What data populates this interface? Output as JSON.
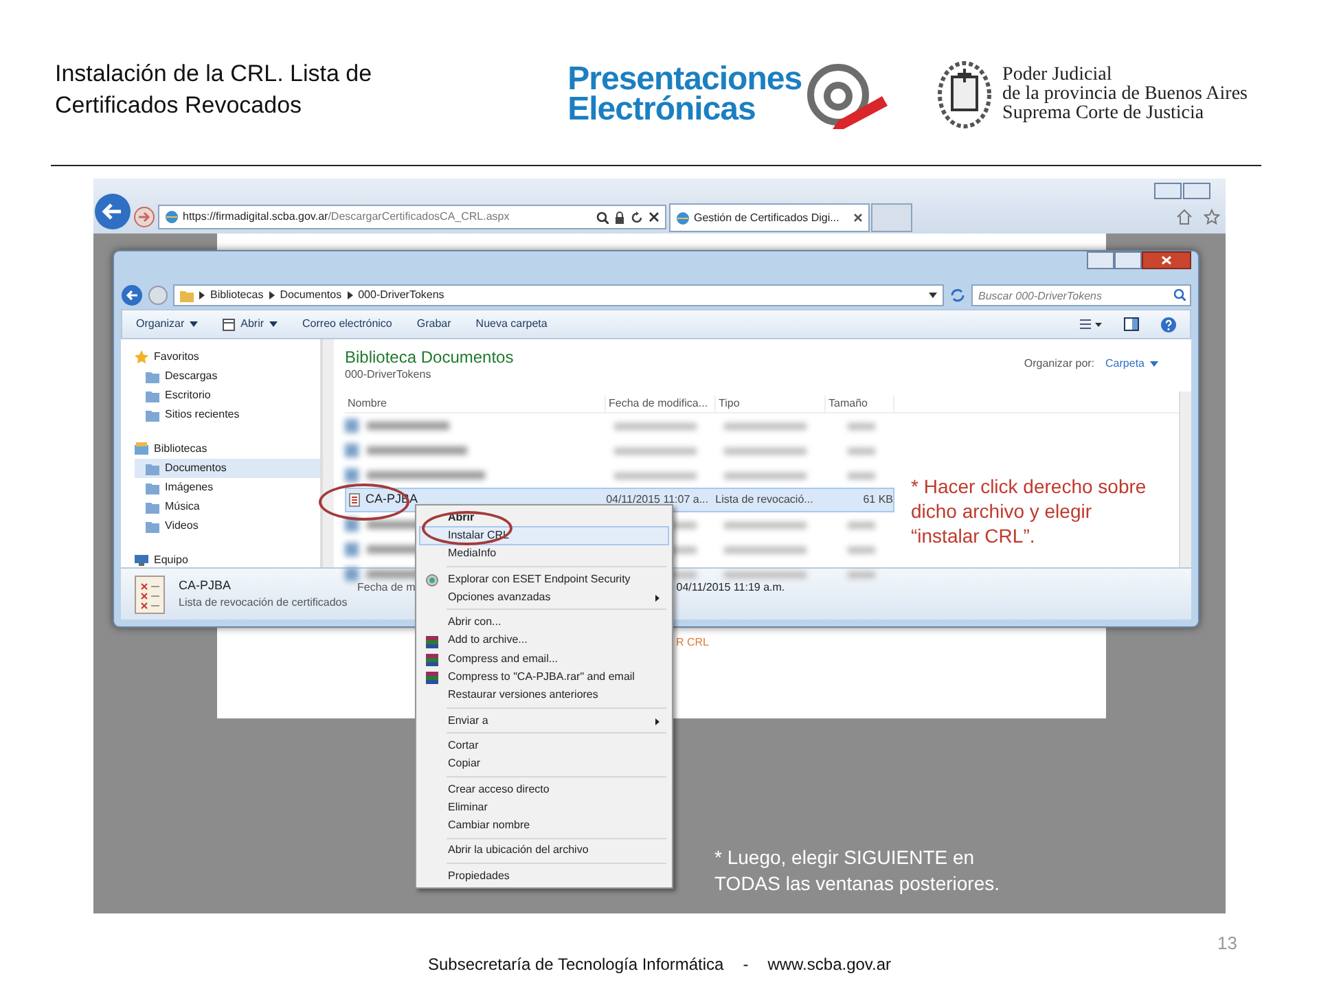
{
  "slide": {
    "title": "Instalación de la CRL. Lista de Certificados Revocados",
    "logo_lines": [
      "Presentaciones",
      "Electrónicas"
    ],
    "court_lines": [
      "Poder Judicial",
      "de la provincia de Buenos Aires",
      "Suprema Corte de Justicia"
    ],
    "footer": [
      "Subsecretaría de Tecnología Informática",
      "-",
      "www.scba.gov.ar"
    ],
    "page_number": "13"
  },
  "browser": {
    "url_host": "https://firmadigital.scba.gov.ar",
    "url_path": "/DescargarCertificadosCA_CRL.aspx",
    "tabs": [
      {
        "label": "Gestión de Certificados Digi...",
        "selected": true
      }
    ]
  },
  "page_fragment": "R CRL",
  "explorer": {
    "breadcrumb": [
      "Bibliotecas",
      "Documentos",
      "000-DriverTokens"
    ],
    "search": {
      "placeholder": "Buscar 000-DriverTokens"
    },
    "toolbar": [
      {
        "label": "Organizar",
        "dropdown": true
      },
      {
        "label": "Abrir",
        "dropdown": true
      },
      {
        "label": "Correo electrónico",
        "dropdown": false
      },
      {
        "label": "Grabar",
        "dropdown": false
      },
      {
        "label": "Nueva carpeta",
        "dropdown": false
      }
    ],
    "sidebar": [
      {
        "label": "Favoritos",
        "selected": false,
        "children": [
          {
            "label": "Descargas",
            "selected": false
          },
          {
            "label": "Escritorio",
            "selected": false
          },
          {
            "label": "Sitios recientes",
            "selected": false
          }
        ]
      },
      {
        "label": "Bibliotecas",
        "selected": false,
        "children": [
          {
            "label": "Documentos",
            "selected": true
          },
          {
            "label": "Imágenes",
            "selected": false
          },
          {
            "label": "Música",
            "selected": false
          },
          {
            "label": "Videos",
            "selected": false
          }
        ]
      },
      {
        "label": "Equipo",
        "selected": false
      }
    ],
    "heading": "Biblioteca Documentos",
    "subheading": "000-DriverTokens",
    "arrange_label": "Organizar por:",
    "arrange_value": "Carpeta",
    "columns": [
      "Nombre",
      "Fecha de modifica...",
      "Tipo",
      "Tamaño"
    ],
    "file": {
      "name": "CA-PJBA",
      "date": "04/11/2015 11:07 a...",
      "type": "Lista de revocació...",
      "size": "61 KB",
      "selected": true
    },
    "details": {
      "name": "CA-PJBA",
      "description": "Lista de revocación de certificados",
      "date_label": "Fecha de m",
      "date_value": "04/11/2015 11:19 a.m."
    }
  },
  "context_menu": [
    {
      "kind": "item",
      "label": "Abrir",
      "bold": true,
      "selected": false,
      "submenu": false
    },
    {
      "kind": "item",
      "label": "Instalar CRL",
      "bold": false,
      "selected": true,
      "submenu": false
    },
    {
      "kind": "item",
      "label": "MediaInfo",
      "bold": false,
      "selected": false,
      "submenu": false
    },
    {
      "kind": "separator"
    },
    {
      "kind": "item",
      "label": "Explorar con ESET Endpoint Security",
      "bold": false,
      "selected": false,
      "submenu": false
    },
    {
      "kind": "item",
      "label": "Opciones avanzadas",
      "bold": false,
      "selected": false,
      "submenu": true
    },
    {
      "kind": "separator"
    },
    {
      "kind": "item",
      "label": "Abrir con...",
      "bold": false,
      "selected": false,
      "submenu": false
    },
    {
      "kind": "item",
      "label": "Add to archive...",
      "bold": false,
      "selected": false,
      "submenu": false
    },
    {
      "kind": "item",
      "label": "Compress and email...",
      "bold": false,
      "selected": false,
      "submenu": false
    },
    {
      "kind": "item",
      "label": "Compress to \"CA-PJBA.rar\" and email",
      "bold": false,
      "selected": false,
      "submenu": false
    },
    {
      "kind": "item",
      "label": "Restaurar versiones anteriores",
      "bold": false,
      "selected": false,
      "submenu": false
    },
    {
      "kind": "separator"
    },
    {
      "kind": "item",
      "label": "Enviar a",
      "bold": false,
      "selected": false,
      "submenu": true
    },
    {
      "kind": "separator"
    },
    {
      "kind": "item",
      "label": "Cortar",
      "bold": false,
      "selected": false,
      "submenu": false
    },
    {
      "kind": "item",
      "label": "Copiar",
      "bold": false,
      "selected": false,
      "submenu": false
    },
    {
      "kind": "separator"
    },
    {
      "kind": "item",
      "label": "Crear acceso directo",
      "bold": false,
      "selected": false,
      "submenu": false
    },
    {
      "kind": "item",
      "label": "Eliminar",
      "bold": false,
      "selected": false,
      "submenu": false
    },
    {
      "kind": "item",
      "label": "Cambiar nombre",
      "bold": false,
      "selected": false,
      "submenu": false
    },
    {
      "kind": "separator"
    },
    {
      "kind": "item",
      "label": "Abrir la ubicación del archivo",
      "bold": false,
      "selected": false,
      "submenu": false
    },
    {
      "kind": "separator"
    },
    {
      "kind": "item",
      "label": "Propiedades",
      "bold": false,
      "selected": false,
      "submenu": false
    }
  ],
  "callouts": [
    {
      "kind": "note",
      "text": "* Hacer click derecho sobre dicho archivo y elegir “instalar CRL”."
    },
    {
      "kind": "instruction",
      "text": "* Luego, elegir SIGUIENTE en TODAS las ventanas posteriores."
    }
  ]
}
